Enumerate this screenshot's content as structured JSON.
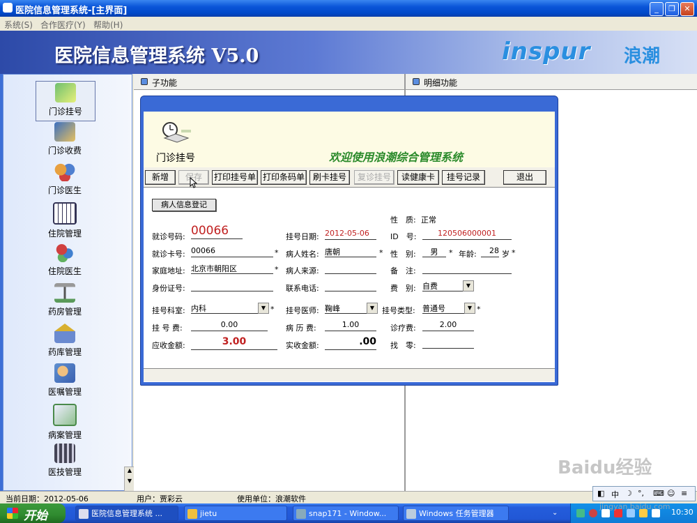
{
  "window": {
    "title": "医院信息管理系统-[主界面]",
    "min": "_",
    "max": "❐",
    "close": "✕"
  },
  "menu": [
    {
      "label": "系统(S)"
    },
    {
      "label": "合作医疗(Y)"
    },
    {
      "label": "帮助(H)"
    }
  ],
  "banner": {
    "title": "医院信息管理系统 V5.0",
    "logo_text": "inspur",
    "logo_cn": "浪潮"
  },
  "sidebar": {
    "items": [
      {
        "label": "门诊挂号",
        "icon": "registration-icon"
      },
      {
        "label": "门诊收费",
        "icon": "cashier-icon"
      },
      {
        "label": "门诊医生",
        "icon": "doctors-icon"
      },
      {
        "label": "住院管理",
        "icon": "calendar-icon"
      },
      {
        "label": "住院医生",
        "icon": "medicine-icon"
      },
      {
        "label": "药房管理",
        "icon": "scale-icon"
      },
      {
        "label": "药库管理",
        "icon": "warehouse-icon"
      },
      {
        "label": "医嘱管理",
        "icon": "prescription-icon"
      },
      {
        "label": "病案管理",
        "icon": "record-icon"
      },
      {
        "label": "医技管理",
        "icon": "tools-icon"
      }
    ]
  },
  "panels": {
    "left": "子功能",
    "right": "明细功能"
  },
  "dialog": {
    "module": "门诊挂号",
    "welcome": "欢迎使用浪潮综合管理系统",
    "buttons": {
      "new": "新增",
      "save": "保存",
      "print_reg": "打印挂号单",
      "print_barcode": "打印条码单",
      "swipe": "刷卡挂号",
      "revisit": "复诊挂号",
      "read_card": "读健康卡",
      "records": "挂号记录",
      "exit": "退出"
    },
    "group": "病人信息登记",
    "labels": {
      "nature": "性　质:",
      "visit_no": "就诊号码:",
      "reg_date": "挂号日期:",
      "id": "ID　号:",
      "card_no": "就诊卡号:",
      "name": "病人姓名:",
      "sex": "性　别:",
      "age": "年龄:",
      "age_unit": "岁",
      "address": "家庭地址:",
      "source": "病人来源:",
      "remark": "备　注:",
      "idcard": "身份证号:",
      "phone": "联系电话:",
      "fee_type": "费　别:",
      "dept": "挂号科室:",
      "doctor": "挂号医师:",
      "reg_type": "挂号类型:",
      "reg_fee": "挂 号 费:",
      "record_fee": "病 历 费:",
      "treat_fee": "诊疗费:",
      "receivable": "应收金额:",
      "received": "实收金额:",
      "change": "找　零:",
      "required": "*"
    },
    "values": {
      "nature": "正常",
      "visit_no": "00066",
      "reg_date": "2012-05-06",
      "id": "120506000001",
      "card_no": "00066",
      "name": "唐朝",
      "sex": "男",
      "age": "28",
      "address": "北京市朝阳区",
      "source": "",
      "remark": "",
      "idcard": "",
      "phone": "",
      "fee_type": "自费",
      "dept": "内科",
      "doctor": "鞠峰",
      "reg_type": "普通号",
      "reg_fee": "0.00",
      "record_fee": "1.00",
      "treat_fee": "2.00",
      "receivable": "3.00",
      "received": ".00",
      "change": ""
    }
  },
  "statusbar": {
    "date": "当前日期：2012-05-06",
    "user": "用户：贾彩云",
    "unit": "使用单位：浪潮软件"
  },
  "taskbar": {
    "start": "开始",
    "tasks": [
      "医院信息管理系统 ...",
      "jietu",
      "snap171 - Window...",
      "Windows 任务管理器"
    ],
    "clock": "10:30"
  },
  "ime": {
    "label": "中"
  },
  "watermark": {
    "text": "Baidu经验",
    "url": "jingyan.baidu.com"
  }
}
